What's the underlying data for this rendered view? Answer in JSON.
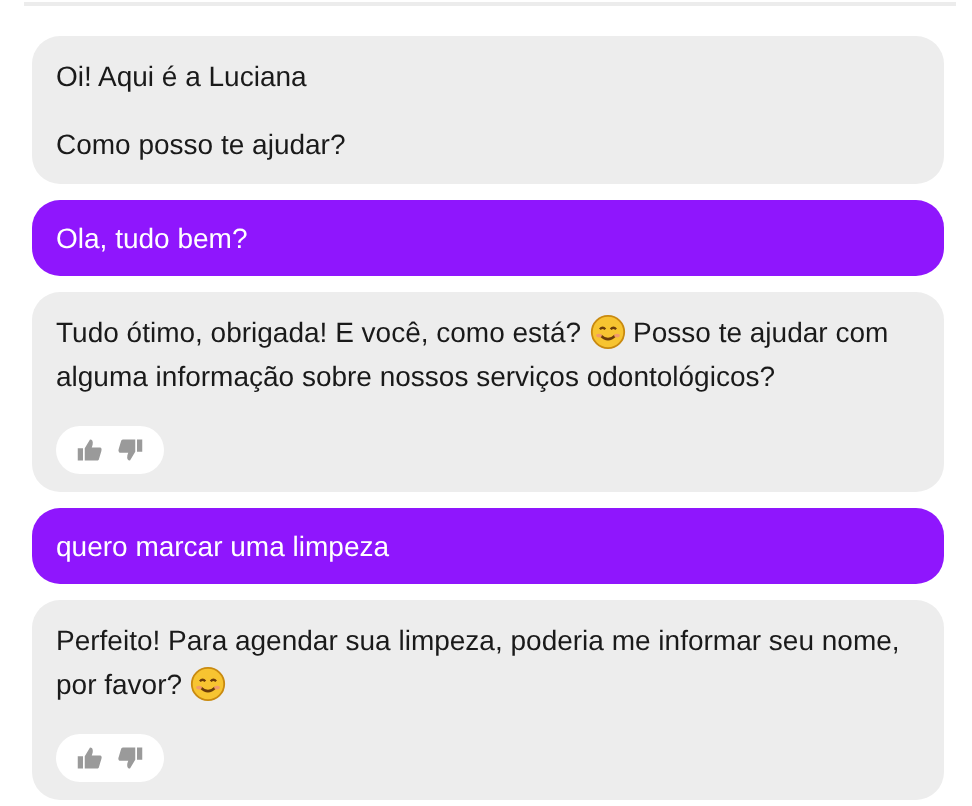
{
  "messages": [
    {
      "kind": "bot",
      "paragraphs": [
        [
          {
            "kind": "text",
            "text": "Oi! Aqui é a Luciana"
          }
        ],
        [
          {
            "kind": "text",
            "text": "Como posso te ajudar?"
          }
        ]
      ],
      "feedback": false
    },
    {
      "kind": "user",
      "paragraphs": [
        [
          {
            "kind": "text",
            "text": "Ola, tudo bem?"
          }
        ]
      ],
      "feedback": false
    },
    {
      "kind": "bot",
      "paragraphs": [
        [
          {
            "kind": "text",
            "text": "Tudo ótimo, obrigada! E você, como está?"
          },
          {
            "kind": "emoji"
          },
          {
            "kind": "text",
            "text": "Posso te ajudar com alguma informação sobre nossos serviços odontológicos?"
          }
        ]
      ],
      "feedback": true
    },
    {
      "kind": "user",
      "paragraphs": [
        [
          {
            "kind": "text",
            "text": "quero marcar uma limpeza"
          }
        ]
      ],
      "feedback": false
    },
    {
      "kind": "bot",
      "paragraphs": [
        [
          {
            "kind": "text",
            "text": "Perfeito! Para agendar sua limpeza, poderia me informar seu nome, por favor?"
          },
          {
            "kind": "emoji"
          }
        ]
      ],
      "feedback": true
    }
  ]
}
